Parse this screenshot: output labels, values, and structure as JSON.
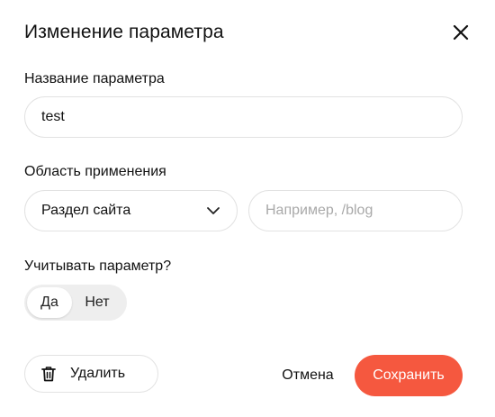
{
  "dialog": {
    "title": "Изменение параметра",
    "close_icon": "close-icon"
  },
  "name_field": {
    "label": "Название параметра",
    "value": "test"
  },
  "scope": {
    "label": "Область применения",
    "selected": "Раздел сайта",
    "dropdown_icon": "chevron-down-icon",
    "path_placeholder": "Например, /blog"
  },
  "consider": {
    "label": "Учитывать параметр?",
    "options": [
      "Да",
      "Нет"
    ],
    "selected": "Да"
  },
  "actions": {
    "delete_label": "Удалить",
    "delete_icon": "trash-icon",
    "cancel_label": "Отмена",
    "save_label": "Сохранить"
  },
  "colors": {
    "accent": "#f5583f",
    "border": "#e2e2e2",
    "toggle_bg": "#eeeeee",
    "placeholder": "#a9a9a9"
  }
}
